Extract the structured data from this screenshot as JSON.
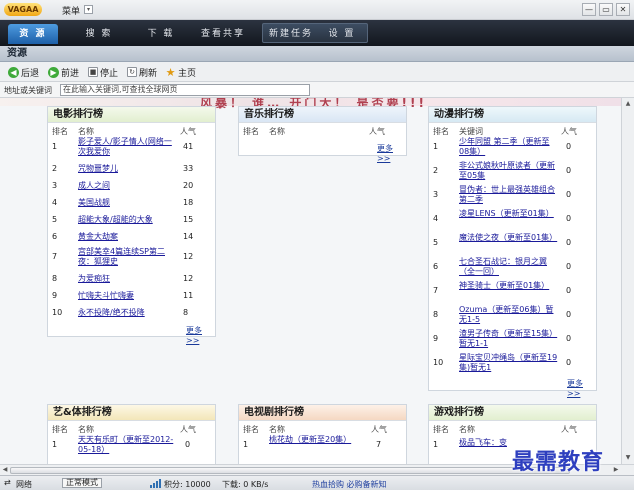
{
  "app": {
    "logo_text": "VAGAA",
    "menu_label": "菜单",
    "menu_arrow": "▾",
    "window_buttons": [
      "—",
      "▭",
      "✕"
    ]
  },
  "tabs": [
    {
      "label": "资 源",
      "active": true
    },
    {
      "label": "搜 索",
      "active": false
    },
    {
      "label": "下 载",
      "active": false
    },
    {
      "label": "查看共享",
      "active": false
    },
    {
      "label": "新建任务",
      "active": false
    },
    {
      "label": "设 置",
      "active": false
    }
  ],
  "section_title": "资源",
  "nav": {
    "back": "后退",
    "forward": "前进",
    "stop": "停止",
    "refresh": "刷新",
    "home": "主页"
  },
  "address": {
    "label": "地址或关键词",
    "value": "在此输入关键词,可查找全球网页"
  },
  "banner_text": "风暴！ 谁… 开门大！ 是否要!!!",
  "panels": {
    "movie": {
      "title": "电影排行榜",
      "col_rank": "排名",
      "col_name": "名称",
      "col_pop": "人气",
      "more": "更多>>",
      "rows": [
        {
          "rank": "1",
          "name": "影子爱人/影子情人(网络一次我爱你",
          "pop": "41"
        },
        {
          "rank": "2",
          "name": "咒物噩梦儿",
          "pop": "33"
        },
        {
          "rank": "3",
          "name": "成人之间",
          "pop": "20"
        },
        {
          "rank": "4",
          "name": "美国战舰",
          "pop": "18"
        },
        {
          "rank": "5",
          "name": "超能大象/超能的大象",
          "pop": "15"
        },
        {
          "rank": "6",
          "name": "黄金大劫案",
          "pop": "14"
        },
        {
          "rank": "7",
          "name": "宫部美幸4篇连续SP第二夜：狐狸史",
          "pop": "12"
        },
        {
          "rank": "8",
          "name": "为爱痴狂",
          "pop": "12"
        },
        {
          "rank": "9",
          "name": "忙嗨夫斗忙嗨妻",
          "pop": "11"
        },
        {
          "rank": "10",
          "name": "永不投降/绝不投降",
          "pop": "8"
        }
      ]
    },
    "music": {
      "title": "音乐排行榜",
      "col_rank": "排名",
      "col_name": "名称",
      "col_pop": "人气",
      "more": "更多>>"
    },
    "anime": {
      "title": "动漫排行榜",
      "col_rank": "排名",
      "col_name": "关键词",
      "col_pop": "人气",
      "more": "更多>>",
      "rows": [
        {
          "rank": "1",
          "name": "少年同盟 第二季（更新至08集）",
          "pop": "0"
        },
        {
          "rank": "2",
          "name": "非公式娘秋叶原读者（更新至05集",
          "pop": "0"
        },
        {
          "rank": "3",
          "name": "冒伪者：世上最强英雄组合 第二季",
          "pop": "0"
        },
        {
          "rank": "4",
          "name": "凌星LENS（更新至01集）",
          "pop": "0"
        },
        {
          "rank": "5",
          "name": "魔法使之夜（更新至01集）",
          "pop": "0"
        },
        {
          "rank": "6",
          "name": "七合圣石战记：银月之翼（全一回）",
          "pop": "0"
        },
        {
          "rank": "7",
          "name": "神圣骑士（更新至01集）",
          "pop": "0"
        },
        {
          "rank": "8",
          "name": "Ozuma（更新至06集）暂无1-5",
          "pop": "0"
        },
        {
          "rank": "9",
          "name": "渣男子传奇（更新至15集）暂无1-1",
          "pop": "0"
        },
        {
          "rank": "10",
          "name": "星际宝贝冲绳岛（更新至19集)暂无1",
          "pop": "0"
        }
      ]
    },
    "variety": {
      "title": "艺&体排行榜",
      "col_rank": "排名",
      "col_name": "名称",
      "col_pop": "人气",
      "rows": [
        {
          "rank": "1",
          "name": "天天有乐町（更新至2012-05-18）",
          "pop": "0"
        }
      ]
    },
    "tv": {
      "title": "电视剧排行榜",
      "col_rank": "排名",
      "col_name": "名称",
      "col_pop": "人气",
      "rows": [
        {
          "rank": "1",
          "name": "桃花劫（更新至20集）",
          "pop": "7"
        }
      ]
    },
    "game": {
      "title": "游戏排行榜",
      "col_rank": "排名",
      "col_name": "名称",
      "col_pop": "人气",
      "rows": [
        {
          "rank": "1",
          "name": "极品飞车：变",
          "pop": ""
        }
      ]
    }
  },
  "status": {
    "network": "网络",
    "mode": "正常模式",
    "points_label": "积分: 10000",
    "download_label": "下载: 0 KB/s",
    "hint": "热血拾购 必购备新知"
  },
  "watermark": "最需教育"
}
